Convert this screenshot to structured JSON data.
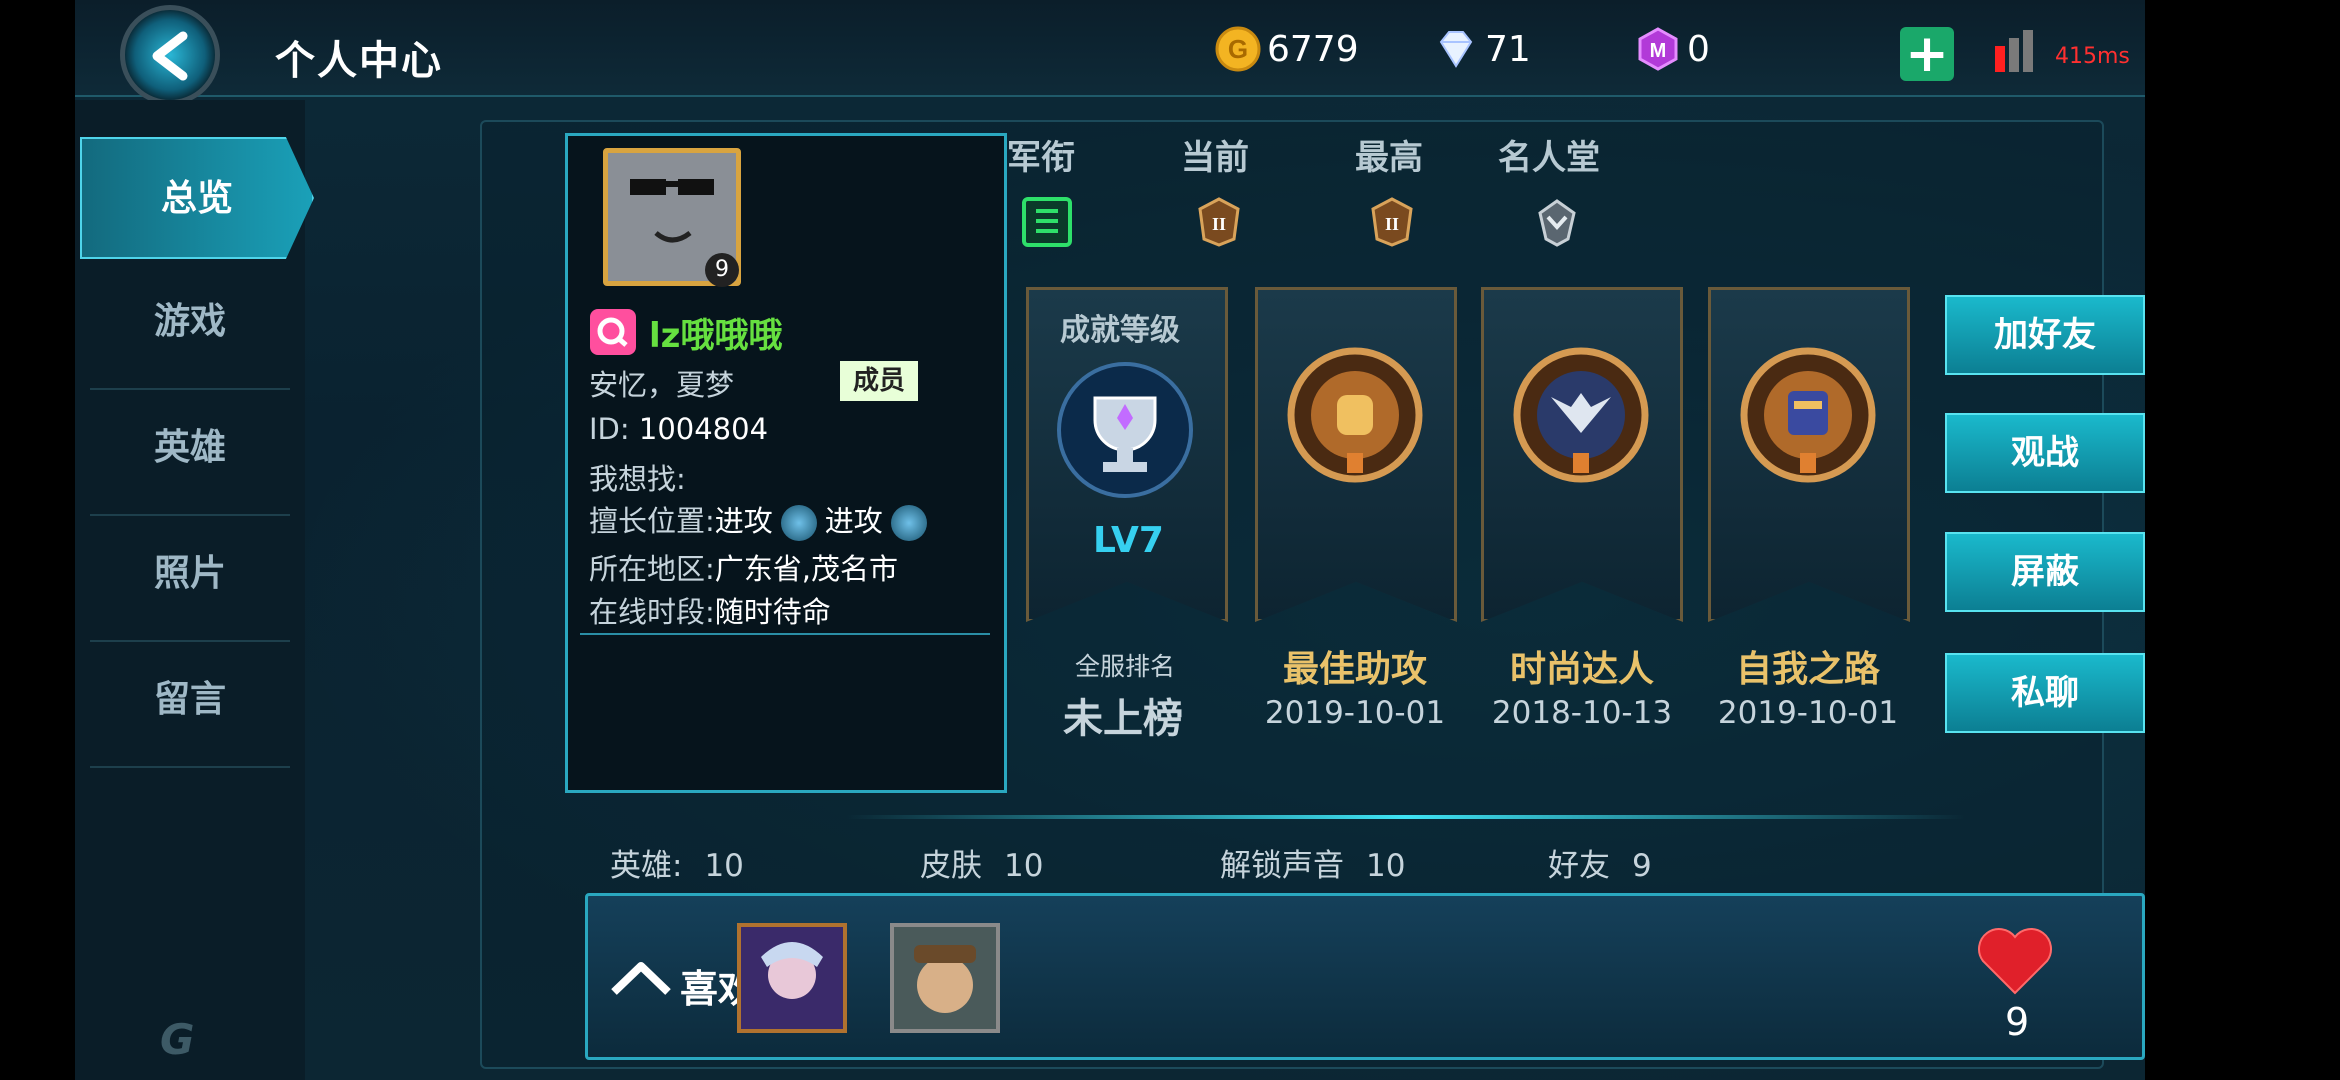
{
  "header": {
    "title": "个人中心",
    "gold": "6779",
    "diamonds": "71",
    "gems": "0",
    "ping": "415ms"
  },
  "sidebar": {
    "items": [
      {
        "label": "总览",
        "active": true
      },
      {
        "label": "游戏"
      },
      {
        "label": "英雄"
      },
      {
        "label": "照片"
      },
      {
        "label": "留言"
      }
    ]
  },
  "profile": {
    "level": "9",
    "name": "lz哦哦哦",
    "guild": "安忆，夏梦",
    "guild_role": "成员",
    "id_label": "ID:",
    "id_value": "1004804",
    "seeking_label": "我想找:",
    "position_label": "擅长位置:",
    "position_1": "进攻",
    "position_2": "进攻",
    "region_label": "所在地区:",
    "region_value": "广东省,茂名市",
    "online_label": "在线时段:",
    "online_value": "随时待命"
  },
  "ranks": {
    "headers": [
      "军衔",
      "当前",
      "最高",
      "名人堂"
    ]
  },
  "achievements": {
    "level_title": "成就等级",
    "level_value": "LV7",
    "server_rank_label": "全服排名",
    "server_rank_value": "未上榜",
    "items": [
      {
        "name": "最佳助攻",
        "date": "2019-10-01"
      },
      {
        "name": "时尚达人",
        "date": "2018-10-13"
      },
      {
        "name": "自我之路",
        "date": "2019-10-01"
      }
    ]
  },
  "actions": {
    "add_friend": "加好友",
    "spectate": "观战",
    "block": "屏蔽",
    "private_chat": "私聊"
  },
  "stats": {
    "heroes_label": "英雄:",
    "heroes_value": "10",
    "skins_label": "皮肤",
    "skins_value": "10",
    "voices_label": "解锁声音",
    "voices_value": "10",
    "friends_label": "好友",
    "friends_value": "9"
  },
  "likes": {
    "label": "喜欢",
    "count": "9"
  },
  "colors": {
    "accent": "#1ab9cc",
    "gold_text": "#e9c26a",
    "name_green": "#66e040",
    "ping_red": "#ff3030"
  }
}
